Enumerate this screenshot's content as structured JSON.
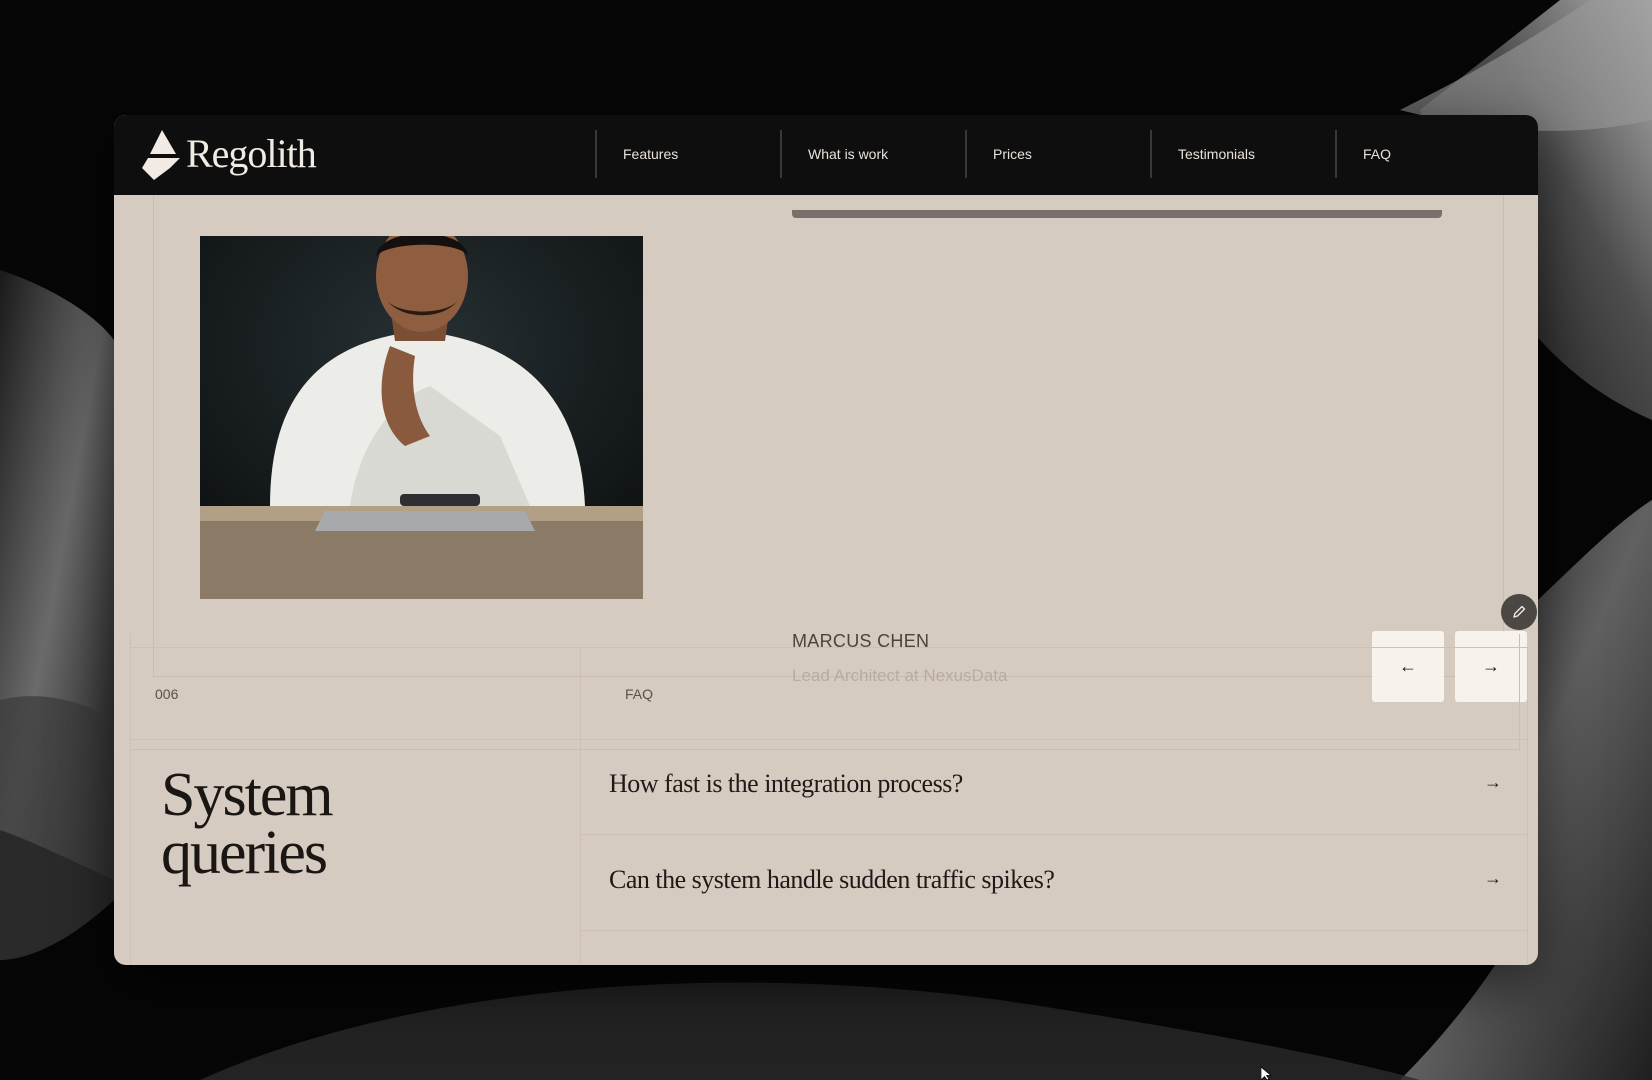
{
  "brand": {
    "name": "Regolith",
    "logo_icon": "regolith-mountain-logo"
  },
  "nav": {
    "items": [
      {
        "label": "Features"
      },
      {
        "label": "What is work"
      },
      {
        "label": "Prices"
      },
      {
        "label": "Testimonials"
      },
      {
        "label": "FAQ"
      }
    ]
  },
  "testimonial": {
    "name": "MARCUS CHEN",
    "role": "Lead Architect at NexusData",
    "prev_icon": "←",
    "next_icon": "→"
  },
  "faq": {
    "number": "006",
    "tag": "FAQ",
    "title_line1": "System",
    "title_line2": "queries",
    "questions": [
      {
        "text": "How fast is the integration process?",
        "icon": "→"
      },
      {
        "text": "Can the system handle sudden traffic spikes?",
        "icon": "→"
      }
    ]
  },
  "colors": {
    "header_bg": "#0f0e0e",
    "page_bg": "#d6cbc0",
    "button_bg": "#f7f2ec",
    "text_dark": "#1a1613"
  }
}
